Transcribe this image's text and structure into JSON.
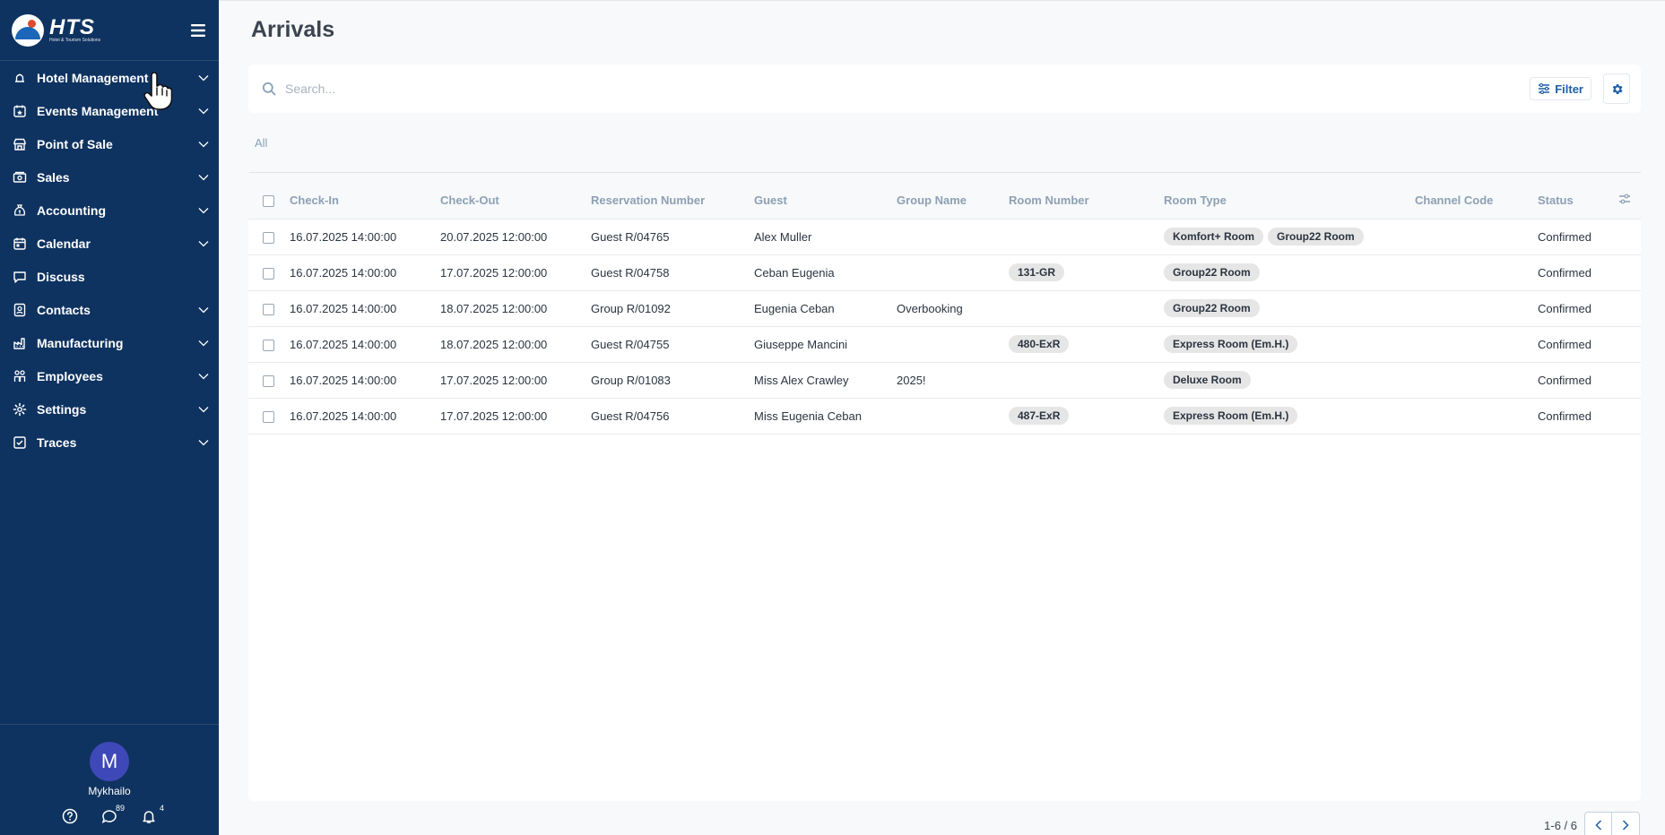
{
  "brand": {
    "title": "HTS",
    "subtitle": "Hotel & Tourism Solutions"
  },
  "sidebar": {
    "items": [
      {
        "label": "Hotel Management",
        "icon": "bell-icon",
        "expandable": true
      },
      {
        "label": "Events Management",
        "icon": "calendar-star-icon",
        "expandable": true
      },
      {
        "label": "Point of Sale",
        "icon": "store-icon",
        "expandable": true
      },
      {
        "label": "Sales",
        "icon": "cash-icon",
        "expandable": true
      },
      {
        "label": "Accounting",
        "icon": "money-bag-icon",
        "expandable": true
      },
      {
        "label": "Calendar",
        "icon": "calendar-icon",
        "expandable": true
      },
      {
        "label": "Discuss",
        "icon": "chat-icon",
        "expandable": false
      },
      {
        "label": "Contacts",
        "icon": "contact-card-icon",
        "expandable": true
      },
      {
        "label": "Manufacturing",
        "icon": "factory-icon",
        "expandable": true
      },
      {
        "label": "Employees",
        "icon": "people-icon",
        "expandable": true
      },
      {
        "label": "Settings",
        "icon": "gear-icon",
        "expandable": true
      },
      {
        "label": "Traces",
        "icon": "checkbox-icon",
        "expandable": true
      }
    ],
    "user": {
      "initial": "M",
      "name": "Mykhailo"
    },
    "messages_count": "89",
    "notifications_count": "4"
  },
  "page": {
    "title": "Arrivals"
  },
  "search": {
    "placeholder": "Search...",
    "filter_label": "Filter"
  },
  "tabs": {
    "all": "All"
  },
  "table": {
    "columns": [
      "Check-In",
      "Check-Out",
      "Reservation Number",
      "Guest",
      "Group Name",
      "Room Number",
      "Room Type",
      "Channel Code",
      "Status"
    ],
    "rows": [
      {
        "check_in": "16.07.2025 14:00:00",
        "check_out": "20.07.2025 12:00:00",
        "reservation": "Guest R/04765",
        "guest": "Alex Muller",
        "group": "",
        "room_number": [],
        "room_type": [
          "Komfort+ Room",
          "Group22 Room"
        ],
        "channel": "",
        "status": "Confirmed"
      },
      {
        "check_in": "16.07.2025 14:00:00",
        "check_out": "17.07.2025 12:00:00",
        "reservation": "Guest R/04758",
        "guest": "Ceban Eugenia",
        "group": "",
        "room_number": [
          "131-GR"
        ],
        "room_type": [
          "Group22 Room"
        ],
        "channel": "",
        "status": "Confirmed"
      },
      {
        "check_in": "16.07.2025 14:00:00",
        "check_out": "18.07.2025 12:00:00",
        "reservation": "Group R/01092",
        "guest": "Eugenia Ceban",
        "group": "Overbooking",
        "room_number": [],
        "room_type": [
          "Group22 Room"
        ],
        "channel": "",
        "status": "Confirmed"
      },
      {
        "check_in": "16.07.2025 14:00:00",
        "check_out": "18.07.2025 12:00:00",
        "reservation": "Guest R/04755",
        "guest": "Giuseppe Mancini",
        "group": "",
        "room_number": [
          "480-ExR"
        ],
        "room_type": [
          "Express Room (Em.H.)"
        ],
        "channel": "",
        "status": "Confirmed"
      },
      {
        "check_in": "16.07.2025 14:00:00",
        "check_out": "17.07.2025 12:00:00",
        "reservation": "Group R/01083",
        "guest": "Miss Alex Crawley",
        "group": "2025!",
        "room_number": [],
        "room_type": [
          "Deluxe Room"
        ],
        "channel": "",
        "status": "Confirmed"
      },
      {
        "check_in": "16.07.2025 14:00:00",
        "check_out": "17.07.2025 12:00:00",
        "reservation": "Guest R/04756",
        "guest": "Miss Eugenia Ceban",
        "group": "",
        "room_number": [
          "487-ExR"
        ],
        "room_type": [
          "Express Room (Em.H.)"
        ],
        "channel": "",
        "status": "Confirmed"
      }
    ]
  },
  "pager": {
    "text": "1-6 / 6"
  },
  "colors": {
    "sidebar_bg": "#0f3360",
    "accent": "#1e5fa8",
    "tag_bg": "#e6e6e6",
    "avatar_bg": "#3f48b8"
  }
}
